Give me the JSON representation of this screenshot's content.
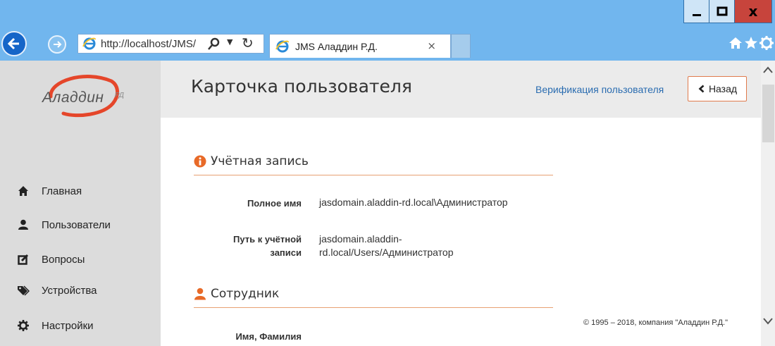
{
  "browser": {
    "address": "http://localhost/JMS/",
    "tab_title": "JMS Аладдин Р.Д.",
    "tab_close": "×",
    "window_close": "x"
  },
  "sidebar": {
    "logo_text": "Аладдин",
    "logo_superscript": "РД",
    "items": [
      {
        "label": "Главная",
        "icon": "home-icon"
      },
      {
        "label": "Пользователи",
        "icon": "user-icon"
      },
      {
        "label": "Вопросы",
        "icon": "edit-icon"
      },
      {
        "label": "Устройства",
        "icon": "tags-icon"
      },
      {
        "label": "Настройки",
        "icon": "cog-icon"
      }
    ]
  },
  "header": {
    "title": "Карточка пользователя",
    "verify_link": "Верификация пользователя",
    "back_label": "Назад"
  },
  "account_section": {
    "title": "Учётная запись",
    "full_name_label": "Полное имя",
    "full_name_value": "jasdomain.aladdin-rd.local\\Администратор",
    "path_label_1": "Путь к учётной",
    "path_label_2": "записи",
    "path_value_1": "jasdomain.aladdin-",
    "path_value_2": "rd.local/Users/Администратор"
  },
  "employee_section": {
    "title": "Сотрудник",
    "name_label": "Имя, Фамилия"
  },
  "footer": {
    "copyright": "© 1995 – 2018, компания \"Аладдин Р.Д.\""
  },
  "colors": {
    "accent": "#e86a28",
    "link": "#2a6cb0",
    "browser_chrome": "#71b6ee",
    "sidebar_bg": "#dcdcdc"
  }
}
